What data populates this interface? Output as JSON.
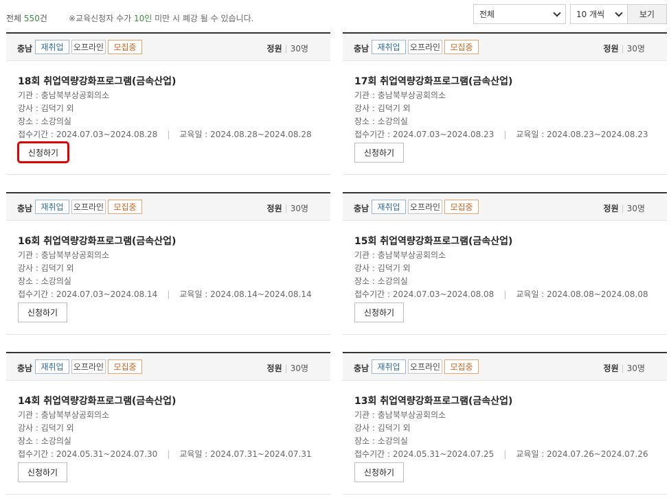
{
  "summary": {
    "total_label": "전체",
    "total_count": "550",
    "total_unit": "건"
  },
  "notice": {
    "prefix": "※교육신청자 수가 ",
    "highlight": "10인",
    "suffix": " 미만 시 폐강 될 수 있습니다."
  },
  "filters": {
    "region": "전체",
    "per_page": "10 개씩",
    "view_button": "보기"
  },
  "cards": [
    {
      "region": "충남",
      "badge1": "재취업",
      "badge2": "오프라인",
      "badge3": "모집중",
      "cap_label": "정원",
      "cap_value": "30명",
      "title": "18회 취업역량강화프로그램(금속산업)",
      "org": "기관 : 충남북부상공회의소",
      "instructor": "강사 : 김덕기 외",
      "place": "장소 : 소강의실",
      "period": "접수기간 : 2024.07.03~2024.08.28",
      "edu_date": "교육일 : 2024.08.28~2024.08.28",
      "apply": "신청하기"
    },
    {
      "region": "충남",
      "badge1": "재취업",
      "badge2": "오프라인",
      "badge3": "모집중",
      "cap_label": "정원",
      "cap_value": "30명",
      "title": "17회 취업역량강화프로그램(금속산업)",
      "org": "기관 : 충남북부상공회의소",
      "instructor": "강사 : 김덕기 외",
      "place": "장소 : 소강의실",
      "period": "접수기간 : 2024.07.03~2024.08.23",
      "edu_date": "교육일 : 2024.08.23~2024.08.23",
      "apply": "신청하기"
    },
    {
      "region": "충남",
      "badge1": "재취업",
      "badge2": "오프라인",
      "badge3": "모집중",
      "cap_label": "정원",
      "cap_value": "30명",
      "title": "16회 취업역량강화프로그램(금속산업)",
      "org": "기관 : 충남북부상공회의소",
      "instructor": "강사 : 김덕기 외",
      "place": "장소 : 소강의실",
      "period": "접수기간 : 2024.07.03~2024.08.14",
      "edu_date": "교육일 : 2024.08.14~2024.08.14",
      "apply": "신청하기"
    },
    {
      "region": "충남",
      "badge1": "재취업",
      "badge2": "오프라인",
      "badge3": "모집중",
      "cap_label": "정원",
      "cap_value": "30명",
      "title": "15회 취업역량강화프로그램(금속산업)",
      "org": "기관 : 충남북부상공회의소",
      "instructor": "강사 : 김덕기 외",
      "place": "장소 : 소강의실",
      "period": "접수기간 : 2024.07.03~2024.08.08",
      "edu_date": "교육일 : 2024.08.08~2024.08.08",
      "apply": "신청하기"
    },
    {
      "region": "충남",
      "badge1": "재취업",
      "badge2": "오프라인",
      "badge3": "모집중",
      "cap_label": "정원",
      "cap_value": "30명",
      "title": "14회 취업역량강화프로그램(금속산업)",
      "org": "기관 : 충남북부상공회의소",
      "instructor": "강사 : 김덕기 외",
      "place": "장소 : 소강의실",
      "period": "접수기간 : 2024.05.31~2024.07.30",
      "edu_date": "교육일 : 2024.07.31~2024.07.31",
      "apply": "신청하기"
    },
    {
      "region": "충남",
      "badge1": "재취업",
      "badge2": "오프라인",
      "badge3": "모집중",
      "cap_label": "정원",
      "cap_value": "30명",
      "title": "13회 취업역량강화프로그램(금속산업)",
      "org": "기관 : 충남북부상공회의소",
      "instructor": "강사 : 김덕기 외",
      "place": "장소 : 소강의실",
      "period": "접수기간 : 2024.05.31~2024.07.25",
      "edu_date": "교육일 : 2024.07.26~2024.07.26",
      "apply": "신청하기"
    }
  ]
}
